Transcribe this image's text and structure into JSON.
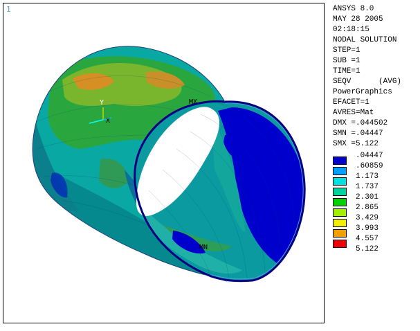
{
  "viewport": {
    "window_number": "1",
    "triad": {
      "y": "Y",
      "x": "X"
    },
    "extrema": {
      "max": "MX",
      "min": "MN"
    }
  },
  "info": {
    "lines": [
      "ANSYS 8.0",
      "MAY 28 2005",
      "02:18:15",
      "NODAL SOLUTION",
      "STEP=1",
      "SUB =1",
      "TIME=1",
      "SEQV      (AVG)",
      "PowerGraphics",
      "EFACET=1",
      "AVRES=Mat",
      "DMX =.044502",
      "SMN =.04447",
      "SMX =5.122"
    ]
  },
  "legend": {
    "values": [
      ".04447",
      ".60859",
      "1.173",
      "1.737",
      "2.301",
      "2.865",
      "3.429",
      "3.993",
      "4.557",
      "5.122"
    ],
    "colors": [
      "#0000cd",
      "#00a0ff",
      "#00e0e0",
      "#00d2a0",
      "#00d200",
      "#a0f000",
      "#f0f000",
      "#f0a000",
      "#f00000"
    ]
  },
  "colors": {
    "outer_base": "#0aa8a2",
    "outer_dark": "#06888f",
    "outer_green": "#2aa63f",
    "outer_lime": "#7ab62d",
    "outer_orange": "#d68f24",
    "inner_base": "#0a9aa0",
    "inner_blue": "#0000cd",
    "rim": "#000080",
    "mesh": "#003c60"
  }
}
